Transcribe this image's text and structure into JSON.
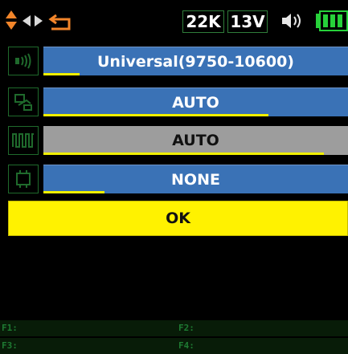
{
  "status_bar": {
    "tone": "22K",
    "voltage": "13V",
    "icons": [
      "updown-arrow-icon",
      "left-arrow-icon",
      "right-arrow-icon",
      "return-icon",
      "speaker-icon",
      "battery-icon"
    ]
  },
  "menu": {
    "rows": [
      {
        "icon": "lnb-icon",
        "value": "Universal(9750-10600)",
        "level": 0.12
      },
      {
        "icon": "switch-icon",
        "value": "AUTO",
        "level": 0.74
      },
      {
        "icon": "band-icon",
        "value": "AUTO",
        "level": 0.92
      },
      {
        "icon": "positioner-icon",
        "value": "NONE",
        "level": 0.2
      }
    ],
    "ok_label": "OK"
  },
  "function_keys": [
    "F1:",
    "F2:",
    "F3:",
    "F4:"
  ],
  "colors": {
    "accent_orange": "#f2852a",
    "field_blue": "#3a72b6",
    "field_selected_grey": "#9d9d9d",
    "ok_yellow": "#fff200",
    "progress_yellow": "#f1f000",
    "frame_green": "#1f6a2c",
    "battery_green": "#27d13a"
  }
}
